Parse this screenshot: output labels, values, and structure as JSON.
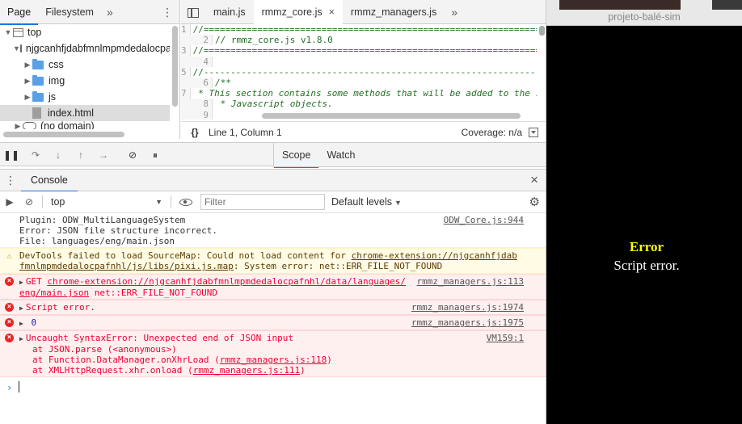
{
  "navigator": {
    "tabs": [
      "Page",
      "Filesystem"
    ],
    "more": "»",
    "kebab": "⋮",
    "tree": [
      {
        "label": "top",
        "type": "frame",
        "depth": 0,
        "expanded": true
      },
      {
        "label": "njgcanhfjdabfmnlmpmdedalocpafnhl",
        "type": "origin",
        "depth": 1,
        "expanded": true
      },
      {
        "label": "css",
        "type": "folder",
        "depth": 2
      },
      {
        "label": "img",
        "type": "folder",
        "depth": 2
      },
      {
        "label": "js",
        "type": "folder",
        "depth": 2
      },
      {
        "label": "index.html",
        "type": "file",
        "depth": 2,
        "selected": true
      },
      {
        "label": "(no domain)",
        "type": "origin",
        "depth": 1
      }
    ]
  },
  "editor": {
    "tabs": [
      {
        "label": "main.js",
        "active": false
      },
      {
        "label": "rmmz_core.js",
        "active": true,
        "closable": true
      },
      {
        "label": "rmmz_managers.js",
        "active": false
      }
    ],
    "more": "»",
    "close": "×",
    "lines": [
      {
        "n": "1",
        "text": "//=============================================================================",
        "style": "comment"
      },
      {
        "n": "2",
        "text": "// rmmz_core.js v1.8.0",
        "style": "comment"
      },
      {
        "n": "3",
        "text": "//=============================================================================",
        "style": "comment"
      },
      {
        "n": "4",
        "text": "",
        "style": "comment"
      },
      {
        "n": "5",
        "text": "//-----------------------------------------------------------------------------",
        "style": "comment"
      },
      {
        "n": "6",
        "text": "/**",
        "style": "doc"
      },
      {
        "n": "7",
        "text": " * This section contains some methods that will be added to the standard",
        "style": "doc"
      },
      {
        "n": "8",
        "text": " * Javascript objects.",
        "style": "doc"
      },
      {
        "n": "9",
        "text": "",
        "style": "comment"
      }
    ],
    "status": {
      "braces": "{}",
      "position": "Line 1, Column 1",
      "coverage": "Coverage: n/a"
    }
  },
  "debugger": {
    "tabs": [
      "Scope",
      "Watch"
    ]
  },
  "console": {
    "drawer_tab": "Console",
    "close": "×",
    "context": "top",
    "filter_placeholder": "Filter",
    "levels": "Default levels",
    "messages": [
      {
        "level": "info",
        "text": "Plugin: ODW_MultiLanguageSystem\nError: JSON file structure incorrect.\nFile: languages/eng/main.json",
        "source": "ODW_Core.js:944"
      },
      {
        "level": "warn",
        "text_prefix": "DevTools failed to load SourceMap: Could not load content for ",
        "link": "chrome-extension://njgcanhfjdabfmnlmpmdedalocpafnhl/js/libs/pixi.js.map",
        "text_suffix": ": System error: net::ERR_FILE_NOT_FOUND",
        "source": ""
      },
      {
        "level": "err",
        "text_prefix": "GET ",
        "link": "chrome-extension://njgcanhfjdabfmnlmpmdedalocpafnhl/data/languages/eng/main.json",
        "text_suffix": " net::ERR_FILE_NOT_FOUND",
        "source": "rmmz_managers.js:113"
      },
      {
        "level": "err",
        "text": "Script error.",
        "source": "rmmz_managers.js:1974"
      },
      {
        "level": "err",
        "text": "0",
        "source": "rmmz_managers.js:1975"
      },
      {
        "level": "err",
        "text": "Uncaught SyntaxError: Unexpected end of JSON input",
        "source": "VM159:1",
        "stack": [
          {
            "text": "at JSON.parse (<anonymous>)",
            "link": ""
          },
          {
            "text": "at Function.DataManager.onXhrLoad (",
            "link": "rmmz_managers.js:118",
            "after": ")"
          },
          {
            "text": "at XMLHttpRequest.xhr.onload (",
            "link": "rmmz_managers.js:111",
            "after": ")"
          }
        ]
      }
    ],
    "prompt": "›"
  },
  "game": {
    "window_title": "projeto-balé-sim",
    "error_title": "Error",
    "error_message": "Script error.",
    "colors": {
      "background": "#000000",
      "error_title": "#ffff00",
      "error_message": "#ffffff"
    }
  }
}
